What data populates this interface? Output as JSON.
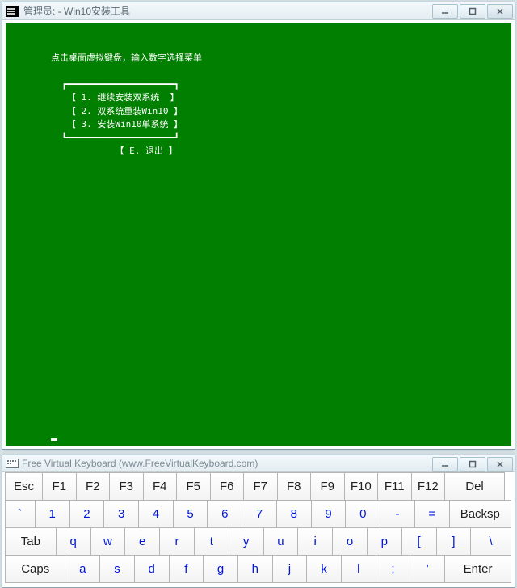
{
  "console": {
    "title": "管理员:  - Win10安装工具",
    "header": "点击桌面虚拟键盘，输入数字选择菜单",
    "divider_top": "┏━━━━━━━━━━━━━━━━━━━━┓",
    "menu": [
      "【 1. 继续安装双系统  】",
      "【 2. 双系统重装Win10 】",
      "【 3. 安装Win10单系统 】"
    ],
    "divider_bot": "┗━━━━━━━━━━━━━━━━━━━━┛",
    "exit": "【 E. 退出 】"
  },
  "keyboard": {
    "title": "Free Virtual Keyboard (www.FreeVirtualKeyboard.com)",
    "rows": {
      "r1": {
        "esc": "Esc",
        "f1": "F1",
        "f2": "F2",
        "f3": "F3",
        "f4": "F4",
        "f5": "F5",
        "f6": "F6",
        "f7": "F7",
        "f8": "F8",
        "f9": "F9",
        "f10": "F10",
        "f11": "F11",
        "f12": "F12",
        "del": "Del"
      },
      "r2": {
        "tick": "`",
        "n1": "1",
        "n2": "2",
        "n3": "3",
        "n4": "4",
        "n5": "5",
        "n6": "6",
        "n7": "7",
        "n8": "8",
        "n9": "9",
        "n0": "0",
        "dash": "-",
        "eq": "=",
        "bksp": "Backsp"
      },
      "r3": {
        "tab": "Tab",
        "q": "q",
        "w": "w",
        "e": "e",
        "r": "r",
        "t": "t",
        "y": "y",
        "u": "u",
        "i": "i",
        "o": "o",
        "p": "p",
        "lb": "[",
        "rb": "]",
        "bs": "\\"
      },
      "r4": {
        "caps": "Caps",
        "a": "a",
        "s": "s",
        "d": "d",
        "f": "f",
        "g": "g",
        "h": "h",
        "j": "j",
        "k": "k",
        "l": "l",
        "sc": ";",
        "ap": "'",
        "enter": "Enter"
      }
    }
  }
}
